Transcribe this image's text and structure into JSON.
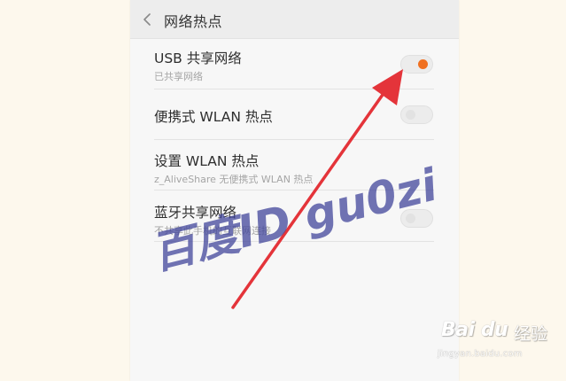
{
  "header": {
    "title": "网络热点"
  },
  "settings": [
    {
      "title": "USB 共享网络",
      "subtitle": "已共享网络",
      "toggle_on": true
    },
    {
      "title": "便携式 WLAN 热点",
      "subtitle": "",
      "toggle_on": false
    },
    {
      "title": "设置 WLAN 热点",
      "subtitle": "z_AliveShare 无便携式 WLAN 热点"
    },
    {
      "title": "蓝牙共享网络",
      "subtitle": "不共享此手机的互联网连接",
      "toggle_on": false
    }
  ],
  "watermark": {
    "text": "百度ID gu0zi"
  },
  "brand": {
    "logo": "Bai du",
    "name": "经验",
    "url": "jingyan.baidu.com"
  },
  "colors": {
    "accent": "#f07020",
    "arrow": "#e4343a",
    "watermark": "#3a3f97"
  }
}
